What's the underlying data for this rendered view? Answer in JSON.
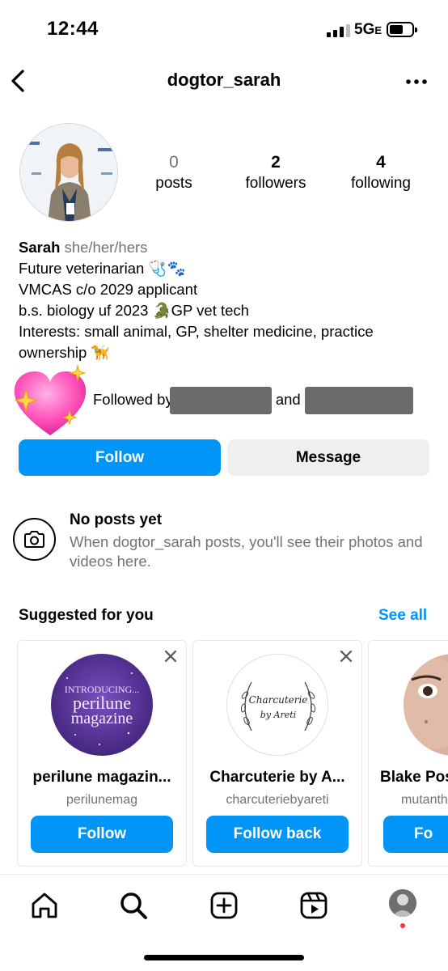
{
  "status_bar": {
    "time": "12:44",
    "network": "5G",
    "network_suffix": "E"
  },
  "header": {
    "username": "dogtor_sarah",
    "back_icon": "chevron-left-icon",
    "more_icon": "more-horizontal-icon"
  },
  "profile": {
    "stats": [
      {
        "value": "0",
        "label": "posts"
      },
      {
        "value": "2",
        "label": "followers"
      },
      {
        "value": "4",
        "label": "following"
      }
    ],
    "name": "Sarah",
    "pronouns": "she/her/hers",
    "bio_lines": [
      "Future veterinarian 🩺🐾",
      "VMCAS c/o 2029 applicant",
      "b.s. biology uf 2023 🐊GP vet tech",
      "Interests: small animal, GP, shelter medicine, practice ownership 🦮"
    ],
    "followed_by_prefix": "Followed by",
    "followed_by_and": "and",
    "followed_by_icon": "sparkling-heart-icon"
  },
  "actions": {
    "follow": "Follow",
    "message": "Message"
  },
  "no_posts": {
    "title": "No posts yet",
    "text": "When dogtor_sarah posts, you'll see their photos and videos here.",
    "icon": "camera-icon"
  },
  "suggested": {
    "title": "Suggested for you",
    "see_all": "See all",
    "cards": [
      {
        "name": "perilune magazin...",
        "handle": "perilunemag",
        "button": "Follow",
        "logo_text_1": "INTRODUCING...",
        "logo_text_2": "perilune",
        "logo_text_3": "magazine"
      },
      {
        "name": "Charcuterie by A...",
        "handle": "charcuteriebyareti",
        "button": "Follow back",
        "logo_text_1": "Charcuterie",
        "logo_text_2": "by Areti"
      },
      {
        "name": "Blake Pos",
        "handle": "mutanth",
        "button": "Fo"
      }
    ]
  },
  "tabbar": {
    "icons": [
      "home-icon",
      "search-icon",
      "create-icon",
      "reels-icon",
      "profile-avatar"
    ]
  },
  "colors": {
    "accent": "#0095f6",
    "secondary_text": "#737373",
    "button_grey": "#efefef",
    "notification_dot": "#ff3040"
  }
}
